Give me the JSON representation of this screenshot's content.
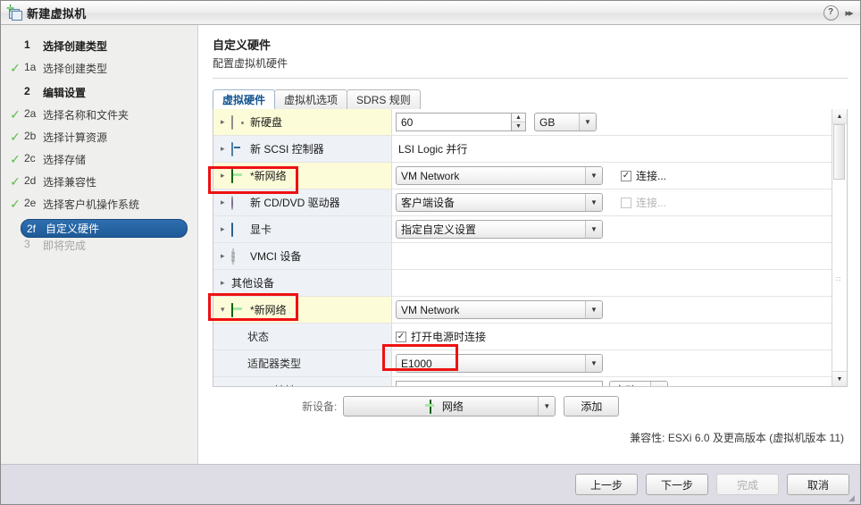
{
  "window": {
    "title": "新建虚拟机",
    "title_icon": "new-vm-icon",
    "help_icon": "?",
    "expand_icon": "▶▶"
  },
  "sidebar": {
    "steps": [
      {
        "num": "1",
        "label": "选择创建类型",
        "state": "major"
      },
      {
        "num": "1a",
        "label": "选择创建类型",
        "state": "done"
      },
      {
        "num": "2",
        "label": "编辑设置",
        "state": "major"
      },
      {
        "num": "2a",
        "label": "选择名称和文件夹",
        "state": "done"
      },
      {
        "num": "2b",
        "label": "选择计算资源",
        "state": "done"
      },
      {
        "num": "2c",
        "label": "选择存储",
        "state": "done"
      },
      {
        "num": "2d",
        "label": "选择兼容性",
        "state": "done"
      },
      {
        "num": "2e",
        "label": "选择客户机操作系统",
        "state": "done"
      },
      {
        "num": "2f",
        "label": "自定义硬件",
        "state": "selected"
      },
      {
        "num": "3",
        "label": "即将完成",
        "state": "dim"
      }
    ]
  },
  "main": {
    "title": "自定义硬件",
    "subtitle": "配置虚拟机硬件",
    "tabs": [
      {
        "label": "虚拟硬件",
        "active": true
      },
      {
        "label": "虚拟机选项",
        "active": false
      },
      {
        "label": "SDRS 规则",
        "active": false
      }
    ],
    "hardware_rows": [
      {
        "label": "新硬盘",
        "icon": "hard-disk-icon",
        "row_style": "new",
        "twisty": "▸",
        "value_kind": "spinner-unit",
        "value": "60",
        "unit": "GB"
      },
      {
        "label": "新 SCSI 控制器",
        "icon": "scsi-controller-icon",
        "row_style": "exist",
        "twisty": "▸",
        "value_kind": "text",
        "value": "LSI Logic 并行"
      },
      {
        "label": "*新网络",
        "icon": "network-adapter-icon",
        "row_style": "new",
        "twisty": "▸",
        "value_kind": "combo-checkbox",
        "value": "VM Network",
        "checkbox_label": "连接...",
        "checkbox_checked": true,
        "checkbox_enabled": true,
        "highlighted": true
      },
      {
        "label": "新 CD/DVD 驱动器",
        "icon": "cd-dvd-icon",
        "row_style": "exist",
        "twisty": "▸",
        "value_kind": "combo-checkbox",
        "value": "客户端设备",
        "checkbox_label": "连接...",
        "checkbox_checked": false,
        "checkbox_enabled": false
      },
      {
        "label": "显卡",
        "icon": "video-card-icon",
        "row_style": "exist",
        "twisty": "▸",
        "value_kind": "combo",
        "value": "指定自定义设置"
      },
      {
        "label": "VMCI 设备",
        "icon": "vmci-device-icon",
        "row_style": "exist",
        "twisty": "▸",
        "value_kind": "empty",
        "value": ""
      },
      {
        "label": "其他设备",
        "icon": "none",
        "row_style": "exist",
        "twisty": "▸",
        "value_kind": "empty",
        "value": ""
      },
      {
        "label": "*新网络",
        "icon": "network-adapter-icon",
        "row_style": "new",
        "twisty": "▾",
        "value_kind": "combo",
        "value": "VM Network",
        "highlighted": true
      },
      {
        "label": "状态",
        "icon": "none",
        "row_style": "sub",
        "twisty": "",
        "value_kind": "checkbox",
        "checkbox_label": "打开电源时连接",
        "checkbox_checked": true,
        "checkbox_enabled": true
      },
      {
        "label": "适配器类型",
        "icon": "none",
        "row_style": "sub",
        "twisty": "",
        "value_kind": "combo",
        "value": "E1000",
        "highlighted": true
      },
      {
        "label": "MAC 地址",
        "icon": "none",
        "row_style": "sub",
        "twisty": "",
        "value_kind": "input-combo",
        "value": "",
        "side_combo": "自动"
      }
    ],
    "new_device": {
      "label": "新设备:",
      "selected": "网络",
      "icon": "network-adapter-icon",
      "add_button": "添加"
    },
    "compatibility": "兼容性: ESXi 6.0 及更高版本 (虚拟机版本 11)"
  },
  "footer": {
    "buttons": [
      {
        "label": "上一步",
        "disabled": false
      },
      {
        "label": "下一步",
        "disabled": false
      },
      {
        "label": "完成",
        "disabled": true
      },
      {
        "label": "取消",
        "disabled": false
      }
    ]
  },
  "colors": {
    "accent": "#2e6fb0",
    "new_device_row": "#fdfcd8",
    "existing_device_row": "#eef2f7",
    "highlight_box": "#ee1111",
    "footer_bar": "#dedde6"
  },
  "scrollbar": {
    "up_arrow": "▲",
    "down_arrow": "▼",
    "grip": "⠿"
  }
}
